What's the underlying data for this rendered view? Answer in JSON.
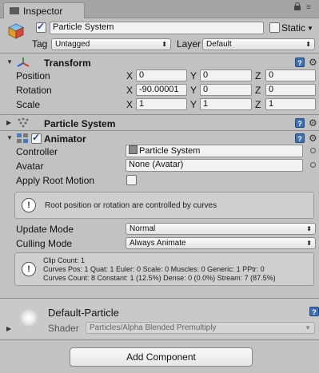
{
  "window": {
    "tab_title": "Inspector"
  },
  "header": {
    "name": "Particle System",
    "static_label": "Static",
    "tag_label": "Tag",
    "tag_value": "Untagged",
    "layer_label": "Layer",
    "layer_value": "Default"
  },
  "transform": {
    "title": "Transform",
    "rows": [
      {
        "label": "Position",
        "x": "0",
        "y": "0",
        "z": "0"
      },
      {
        "label": "Rotation",
        "x": "-90.00001",
        "y": "0",
        "z": "0"
      },
      {
        "label": "Scale",
        "x": "1",
        "y": "1",
        "z": "1"
      }
    ],
    "axis_x": "X",
    "axis_y": "Y",
    "axis_z": "Z"
  },
  "particle_system": {
    "title": "Particle System"
  },
  "animator": {
    "title": "Animator",
    "controller_label": "Controller",
    "controller_value": "Particle System",
    "avatar_label": "Avatar",
    "avatar_value": "None (Avatar)",
    "apply_root_motion_label": "Apply Root Motion",
    "root_info": "Root position or rotation are controlled by curves",
    "update_mode_label": "Update Mode",
    "update_mode_value": "Normal",
    "culling_mode_label": "Culling Mode",
    "culling_mode_value": "Always Animate",
    "clip_info": [
      "Clip Count: 1",
      "Curves Pos: 1 Quat: 1 Euler: 0 Scale: 0 Muscles: 0 Generic: 1 PPtr: 0",
      "Curves Count: 8 Constant: 1 (12.5%) Dense: 0 (0.0%) Stream: 7 (87.5%)"
    ]
  },
  "material": {
    "name": "Default-Particle",
    "shader_label": "Shader",
    "shader_value": "Particles/Alpha Blended Premultiply"
  },
  "add_component_label": "Add Component"
}
